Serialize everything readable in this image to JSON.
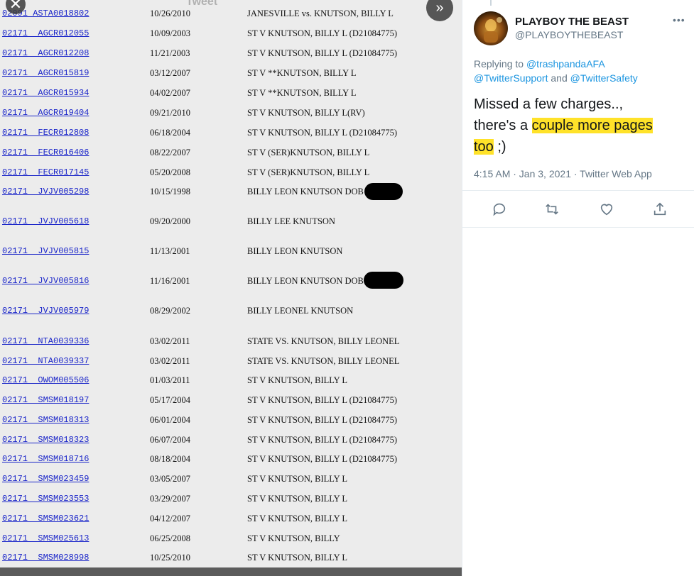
{
  "viewer": {
    "header_ghost": "Tweet",
    "close_icon": "close-icon",
    "next_icon": "double-chevron-right-icon",
    "rows": [
      {
        "case": "02091 ASTA0018802",
        "date": "10/26/2010",
        "party": "JANESVILLE vs. KNUTSON, BILLY L"
      },
      {
        "case": "02171  AGCR012055",
        "date": "10/09/2003",
        "party": "ST V KNUTSON, BILLY L (D21084775)"
      },
      {
        "case": "02171  AGCR012208",
        "date": "11/21/2003",
        "party": "ST V KNUTSON, BILLY L (D21084775)"
      },
      {
        "case": "02171  AGCR015819",
        "date": "03/12/2007",
        "party": "ST V **KNUTSON, BILLY L"
      },
      {
        "case": "02171  AGCR015934",
        "date": "04/02/2007",
        "party": "ST V **KNUTSON, BILLY L"
      },
      {
        "case": "02171  AGCR019404",
        "date": "09/21/2010",
        "party": "ST V KNUTSON, BILLY L(RV)"
      },
      {
        "case": "02171  FECR012808",
        "date": "06/18/2004",
        "party": "ST V KNUTSON, BILLY L (D21084775)"
      },
      {
        "case": "02171  FECR016406",
        "date": "08/22/2007",
        "party": "ST V (SER)KNUTSON, BILLY L"
      },
      {
        "case": "02171  FECR017145",
        "date": "05/20/2008",
        "party": "ST V (SER)KNUTSON, BILLY L"
      },
      {
        "case": "02171  JVJV005298",
        "date": "10/15/1998",
        "party": "BILLY LEON KNUTSON DOB"
      },
      {
        "case": "02171  JVJV005618",
        "date": "09/20/2000",
        "party": "BILLY LEE KNUTSON"
      },
      {
        "case": "02171  JVJV005815",
        "date": "11/13/2001",
        "party": "BILLY LEON KNUTSON"
      },
      {
        "case": "02171  JVJV005816",
        "date": "11/16/2001",
        "party": "BILLY LEON KNUTSON DOB"
      },
      {
        "case": "02171  JVJV005979",
        "date": "08/29/2002",
        "party": "BILLY LEONEL KNUTSON"
      },
      {
        "case": "02171  NTA0039336",
        "date": "03/02/2011",
        "party": "STATE VS. KNUTSON, BILLY LEONEL"
      },
      {
        "case": "02171  NTA0039337",
        "date": "03/02/2011",
        "party": "STATE VS. KNUTSON, BILLY LEONEL"
      },
      {
        "case": "02171  OWOM005506",
        "date": "01/03/2011",
        "party": "ST V KNUTSON, BILLY L"
      },
      {
        "case": "02171  SMSM018197",
        "date": "05/17/2004",
        "party": "ST V KNUTSON, BILLY L (D21084775)"
      },
      {
        "case": "02171  SMSM018313",
        "date": "06/01/2004",
        "party": "ST V KNUTSON, BILLY L (D21084775)"
      },
      {
        "case": "02171  SMSM018323",
        "date": "06/07/2004",
        "party": "ST V KNUTSON, BILLY L (D21084775)"
      },
      {
        "case": "02171  SMSM018716",
        "date": "08/18/2004",
        "party": "ST V KNUTSON, BILLY L (D21084775)"
      },
      {
        "case": "02171  SMSM023459",
        "date": "03/05/2007",
        "party": "ST V KNUTSON, BILLY L"
      },
      {
        "case": "02171  SMSM023553",
        "date": "03/29/2007",
        "party": "ST V KNUTSON, BILLY L"
      },
      {
        "case": "02171  SMSM023621",
        "date": "04/12/2007",
        "party": "ST V KNUTSON, BILLY L"
      },
      {
        "case": "02171  SMSM025613",
        "date": "06/25/2008",
        "party": "ST V KNUTSON, BILLY"
      },
      {
        "case": "02171  SMSM028998",
        "date": "10/25/2010",
        "party": "ST V KNUTSON, BILLY L"
      }
    ]
  },
  "tweet": {
    "display_name": "PLAYBOY THE BEAST",
    "handle": "@PLAYBOYTHEBEAST",
    "more_icon": "more-icon",
    "replying_prefix": "Replying to",
    "mention1": "@trashpandaAFA",
    "mention2": "@TwitterSupport",
    "and": "and",
    "mention3": "@TwitterSafety",
    "text_part1": "Missed a few charges..,",
    "text_part2": "there's a",
    "text_highlight1": "couple more pages",
    "text_highlight2": "too",
    "text_part3": ";)",
    "meta": "4:15 AM · Jan 3, 2021 · Twitter Web App",
    "highlight_color": "#ffe229",
    "accent_color": "#1b95e0"
  }
}
